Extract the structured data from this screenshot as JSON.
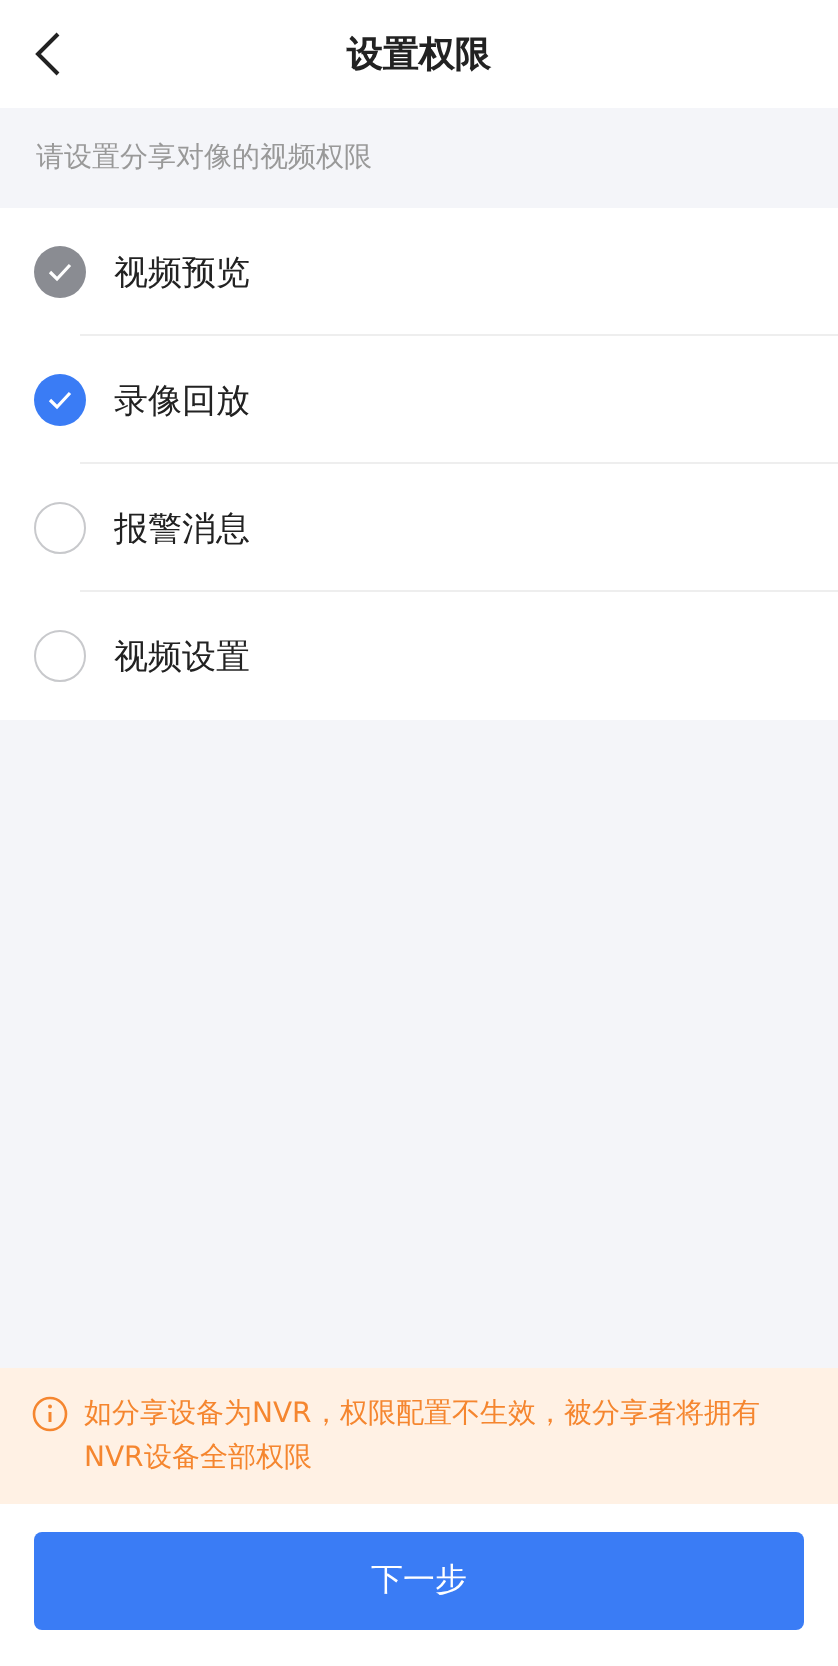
{
  "header": {
    "title": "设置权限"
  },
  "hint": "请设置分享对像的视频权限",
  "permissions": [
    {
      "label": "视频预览",
      "checked": true,
      "disabled": true
    },
    {
      "label": "录像回放",
      "checked": true,
      "disabled": false
    },
    {
      "label": "报警消息",
      "checked": false,
      "disabled": false
    },
    {
      "label": "视频设置",
      "checked": false,
      "disabled": false
    }
  ],
  "notice": "如分享设备为NVR，权限配置不生效，被分享者将拥有NVR设备全部权限",
  "next_button": "下一步"
}
